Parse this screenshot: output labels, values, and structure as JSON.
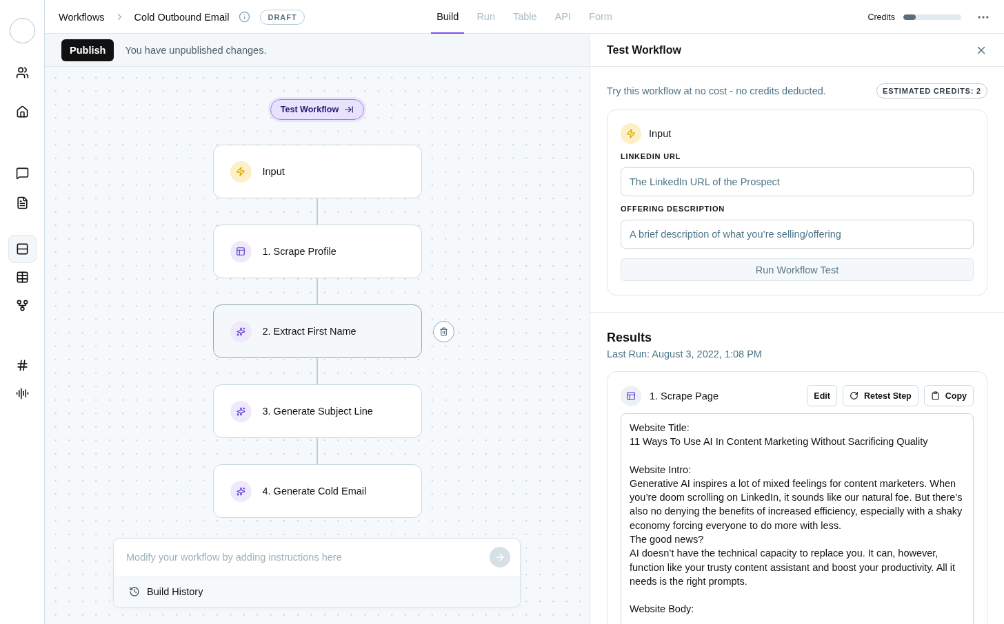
{
  "sidebar": {
    "items": [
      {
        "kind": "users",
        "selected": false
      },
      {
        "kind": "home",
        "selected": false
      },
      {
        "kind": "chat",
        "selected": false
      },
      {
        "kind": "document",
        "selected": false
      },
      {
        "kind": "workflows",
        "selected": true
      },
      {
        "kind": "table",
        "selected": false
      },
      {
        "kind": "graph",
        "selected": false
      },
      {
        "kind": "hash",
        "selected": false
      },
      {
        "kind": "audio",
        "selected": false
      }
    ]
  },
  "breadcrumbs": {
    "root": "Workflows",
    "current": "Cold Outbound Email",
    "status": "DRAFT"
  },
  "tabs": [
    {
      "label": "Build",
      "selected": true
    },
    {
      "label": "Run",
      "selected": false
    },
    {
      "label": "Table",
      "selected": false
    },
    {
      "label": "API",
      "selected": false
    },
    {
      "label": "Form",
      "selected": false
    }
  ],
  "credits": {
    "label": "Credits",
    "level": 0.22
  },
  "publish_bar": {
    "button": "Publish",
    "message": "You have unpublished changes."
  },
  "canvas": {
    "test_button": "Test Workflow",
    "nodes": [
      {
        "kind": "input",
        "label": "Input",
        "selected": false
      },
      {
        "kind": "scrape",
        "label": "1. Scrape Profile",
        "selected": false
      },
      {
        "kind": "ai",
        "label": "2. Extract First Name",
        "selected": true
      },
      {
        "kind": "ai",
        "label": "3. Generate Subject Line",
        "selected": false
      },
      {
        "kind": "ai",
        "label": "4. Generate Cold Email",
        "selected": false
      }
    ],
    "prompt": {
      "placeholder": "Modify your workflow by adding instructions here",
      "history": "Build History"
    }
  },
  "test_panel": {
    "title": "Test Workflow",
    "note": "Try this workflow at no cost - no credits deducted.",
    "estimate": "ESTIMATED CREDITS: 2",
    "input_card": {
      "title": "Input",
      "fields": [
        {
          "label": "LINKEDIN URL",
          "placeholder": "The LinkedIn URL of the Prospect"
        },
        {
          "label": "OFFERING DESCRIPTION",
          "placeholder": "A brief description of what you’re selling/offering"
        }
      ],
      "button": "Run Workflow Test"
    },
    "results": {
      "title": "Results",
      "last_run": "Last Run: August 3, 2022, 1:08 PM",
      "step": {
        "title": "1. Scrape Page",
        "actions": [
          {
            "kind": "edit",
            "label": "Edit"
          },
          {
            "kind": "retest",
            "label": "Retest Step"
          },
          {
            "kind": "copy",
            "label": "Copy"
          }
        ],
        "sections": [
          {
            "heading": "Website Title:",
            "lines": [
              "11 Ways To Use AI In Content Marketing Without Sacrificing Quality"
            ]
          },
          {
            "heading": "Website Intro:",
            "lines": [
              "Generative AI inspires a lot of mixed feelings for content marketers. When you’re doom scrolling on LinkedIn, it sounds like our natural foe. But there’s also no denying the benefits of increased efficiency, especially with a shaky economy forcing everyone to do more with less.",
              "The good news?",
              "AI doesn’t have the technical capacity to replace you. It can, however, function like your trusty content assistant and boost your productivity. All it needs is the right prompts."
            ]
          },
          {
            "heading": "Website Body:"
          }
        ]
      }
    }
  }
}
